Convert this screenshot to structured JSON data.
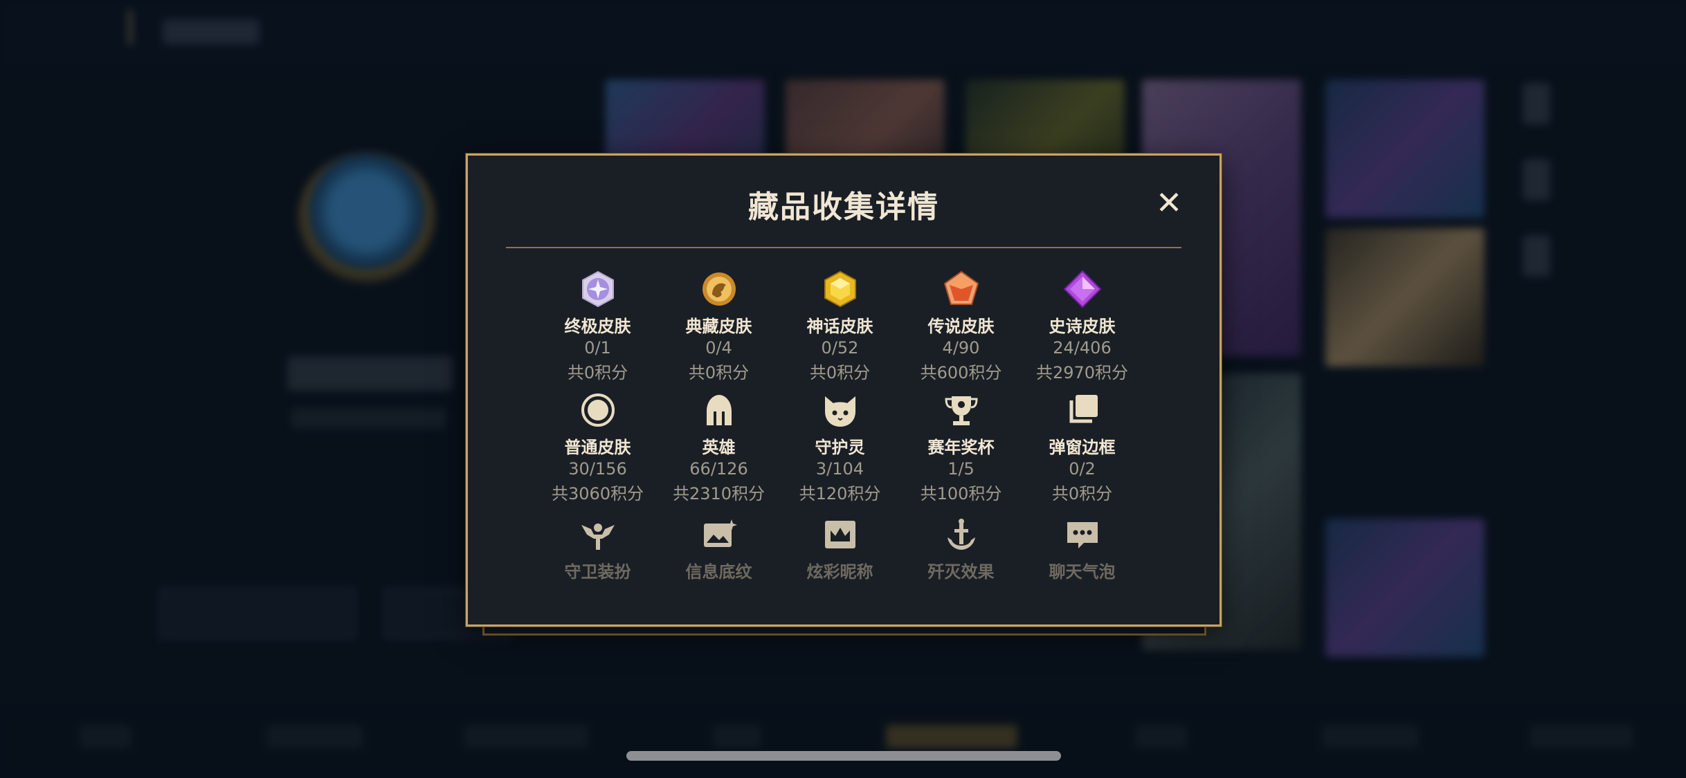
{
  "modal": {
    "title": "藏品收集详情",
    "close_label": "✕",
    "categories": [
      {
        "label": "终极皮肤",
        "count": "0/1",
        "score": "共0积分",
        "icon": "ultimate-skin-icon"
      },
      {
        "label": "典藏皮肤",
        "count": "0/4",
        "score": "共0积分",
        "icon": "prestige-skin-icon"
      },
      {
        "label": "神话皮肤",
        "count": "0/52",
        "score": "共0积分",
        "icon": "mythic-skin-icon"
      },
      {
        "label": "传说皮肤",
        "count": "4/90",
        "score": "共600积分",
        "icon": "legendary-skin-icon"
      },
      {
        "label": "史诗皮肤",
        "count": "24/406",
        "score": "共2970积分",
        "icon": "epic-skin-icon"
      },
      {
        "label": "普通皮肤",
        "count": "30/156",
        "score": "共3060积分",
        "icon": "normal-skin-icon"
      },
      {
        "label": "英雄",
        "count": "66/126",
        "score": "共2310积分",
        "icon": "helmet-icon"
      },
      {
        "label": "守护灵",
        "count": "3/104",
        "score": "共120积分",
        "icon": "guardian-icon"
      },
      {
        "label": "赛年奖杯",
        "count": "1/5",
        "score": "共100积分",
        "icon": "trophy-icon"
      },
      {
        "label": "弹窗边框",
        "count": "0/2",
        "score": "共0积分",
        "icon": "frame-icon"
      },
      {
        "label": "守卫装扮",
        "icon": "ward-icon"
      },
      {
        "label": "信息底纹",
        "icon": "card-icon"
      },
      {
        "label": "炫彩昵称",
        "icon": "crown-icon"
      },
      {
        "label": "歼灭效果",
        "icon": "anchor-icon"
      },
      {
        "label": "聊天气泡",
        "icon": "chat-bubble-icon"
      }
    ]
  },
  "colors": {
    "gold_border": "#c8a464",
    "title_text": "#f0e6d2",
    "muted_text": "#a09b8c",
    "modal_bg": "#1a1f26"
  }
}
